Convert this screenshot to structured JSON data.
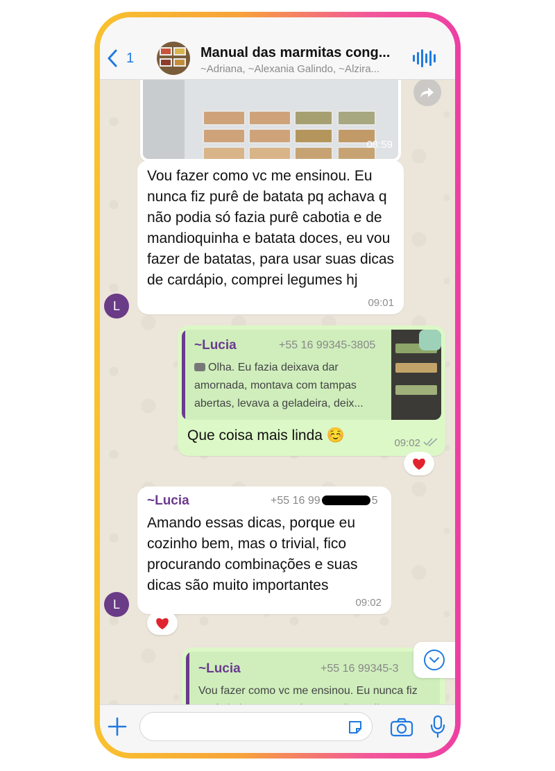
{
  "header": {
    "back_count": "1",
    "title": "Manual das marmitas cong...",
    "subtitle": "~Adriana, ~Alexania Galindo, ~Alzira..."
  },
  "messages": {
    "photo_time": "08:59",
    "m1": {
      "text": "Vou fazer como vc me ensinou. Eu nunca fiz purê de batata pq achava q não podia só fazia purê cabotia e de mandioquinha e batata doces, eu vou fazer de batatas, para usar suas dicas de cardápio, comprei legumes hj",
      "time": "09:01",
      "avatar_initial": "L"
    },
    "m2": {
      "quote_name": "~Lucia",
      "quote_phone": "+55 16 99345-3805",
      "quote_text": "Olha. Eu fazia deixava dar amornada, montava com tampas abertas, levava a geladeira, deix...",
      "text": "Que coisa mais linda ☺️",
      "time": "09:02",
      "reaction": "heart"
    },
    "m3": {
      "sender": "~Lucia",
      "phone": "+55 16 99",
      "phone_end": "5",
      "text": "Amando essas dicas, porque eu cozinho bem, mas o trivial, fico procurando combinações e suas dicas são muito importantes",
      "time": "09:02",
      "avatar_initial": "L",
      "reaction": "heart"
    },
    "m4": {
      "quote_name": "~Lucia",
      "quote_phone": "+55 16 99345-3",
      "quote_text": "Vou fazer como vc me ensinou. Eu nunca fiz purê de batata pq achava q não podia"
    }
  },
  "icons": {
    "back": "chevron-left-icon",
    "audio": "waveform-icon",
    "forward": "forward-icon",
    "scroll": "chevron-down-circle-icon",
    "add": "plus-icon",
    "sticker": "sticker-icon",
    "camera": "camera-icon",
    "mic": "microphone-icon"
  },
  "colors": {
    "accent": "#1f7ae0",
    "outgoing": "#dcf8c6",
    "sender": "#6b3a8e",
    "heart": "#e0232e"
  }
}
